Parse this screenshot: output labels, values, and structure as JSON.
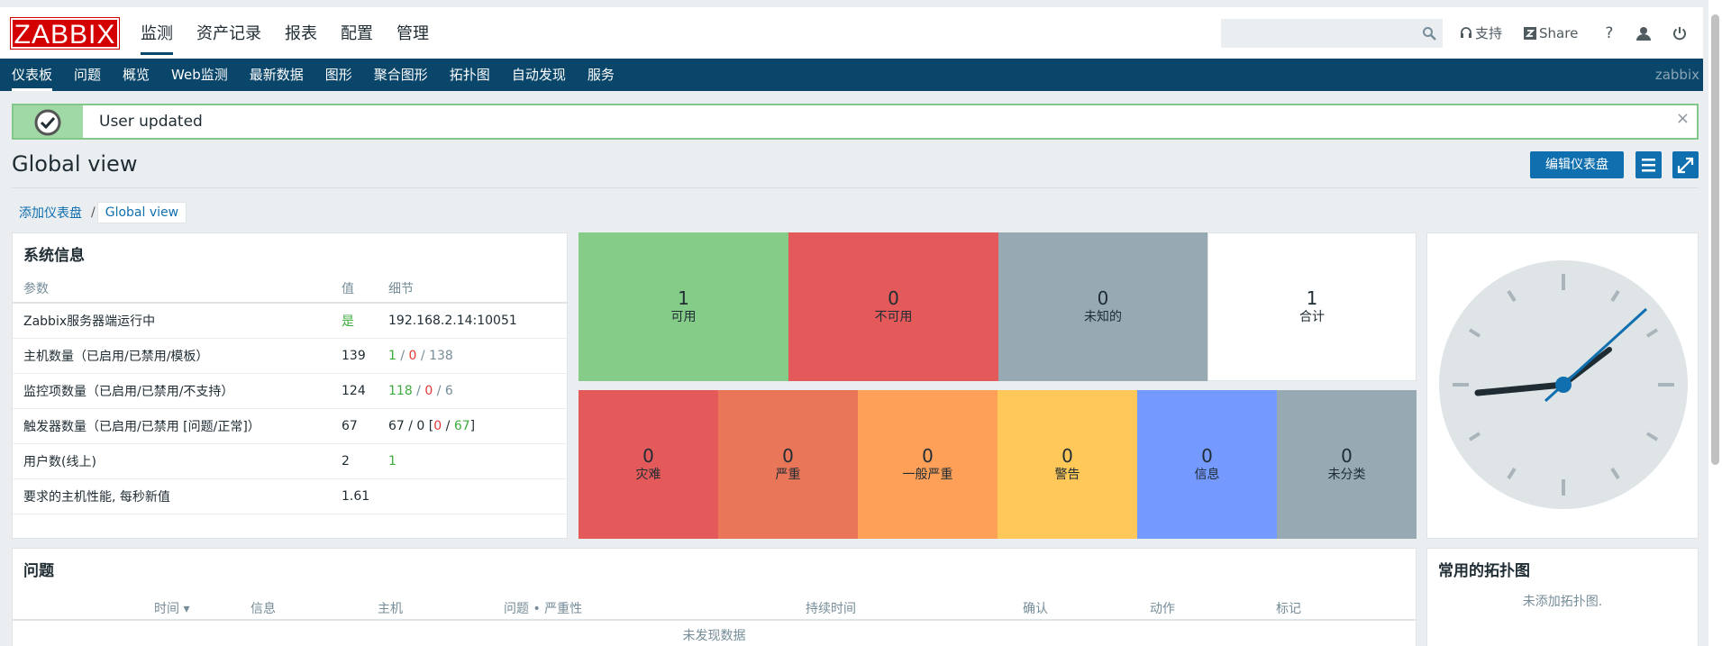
{
  "header": {
    "logo": "ZABBIX",
    "menu": [
      "监测",
      "资产记录",
      "报表",
      "配置",
      "管理"
    ],
    "support": "支持",
    "share": "Share",
    "help": "?"
  },
  "submenu": {
    "items": [
      "仪表板",
      "问题",
      "概览",
      "Web监测",
      "最新数据",
      "图形",
      "聚合图形",
      "拓扑图",
      "自动发现",
      "服务"
    ],
    "user": "zabbix"
  },
  "message": {
    "text": "User updated",
    "close": "×"
  },
  "page": {
    "title": "Global view",
    "edit_button": "编辑仪表盘"
  },
  "breadcrumb": {
    "parent": "添加仪表盘",
    "sep": "/",
    "current": "Global view"
  },
  "sysinfo": {
    "title": "系统信息",
    "headers": [
      "参数",
      "值",
      "细节"
    ],
    "rows": [
      {
        "param": "Zabbix服务器端运行中",
        "value": "是",
        "d1": "192.168.2.14:10051",
        "d2": "",
        "d3": "",
        "d4": "",
        "d5": "",
        "d6": ""
      },
      {
        "param": "主机数量（已启用/已禁用/模板）",
        "value": "139",
        "d1": "1",
        "d2": " / ",
        "d3": "0",
        "d4": " / ",
        "d5": "138",
        "d6": ""
      },
      {
        "param": "监控项数量（已启用/已禁用/不支持）",
        "value": "124",
        "d1": "118",
        "d2": " / ",
        "d3": "0",
        "d4": " / ",
        "d5": "6",
        "d6": ""
      },
      {
        "param": "触发器数量（已启用/已禁用 [问题/正常]）",
        "value": "67",
        "d1": "67 / 0 [",
        "d2": "0",
        "d3": " / ",
        "d4": "67",
        "d5": "]",
        "d6": ""
      },
      {
        "param": "用户数(线上)",
        "value": "2",
        "d1": "1",
        "d2": "",
        "d3": "",
        "d4": "",
        "d5": "",
        "d6": ""
      },
      {
        "param": "要求的主机性能, 每秒新值",
        "value": "1.61",
        "d1": "",
        "d2": "",
        "d3": "",
        "d4": "",
        "d5": "",
        "d6": ""
      }
    ]
  },
  "host_availability": [
    {
      "n": "1",
      "l": "可用",
      "color": "#86cc89"
    },
    {
      "n": "0",
      "l": "不可用",
      "color": "#e45959"
    },
    {
      "n": "0",
      "l": "未知的",
      "color": "#97aab3"
    },
    {
      "n": "1",
      "l": "合计",
      "color": "#ffffff"
    }
  ],
  "severity": [
    {
      "n": "0",
      "l": "灾难",
      "color": "#e45959"
    },
    {
      "n": "0",
      "l": "严重",
      "color": "#e97659"
    },
    {
      "n": "0",
      "l": "一般严重",
      "color": "#ffa059"
    },
    {
      "n": "0",
      "l": "警告",
      "color": "#ffc859"
    },
    {
      "n": "0",
      "l": "信息",
      "color": "#7499ff"
    },
    {
      "n": "0",
      "l": "未分类",
      "color": "#97aab3"
    }
  ],
  "problems": {
    "title": "问题",
    "cols": [
      "时间 ▾",
      "信息",
      "主机",
      "问题 • 严重性",
      "持续时间",
      "确认",
      "动作",
      "标记"
    ],
    "empty": "未发现数据"
  },
  "maps": {
    "title": "常用的拓扑图",
    "empty": "未添加拓扑图."
  }
}
